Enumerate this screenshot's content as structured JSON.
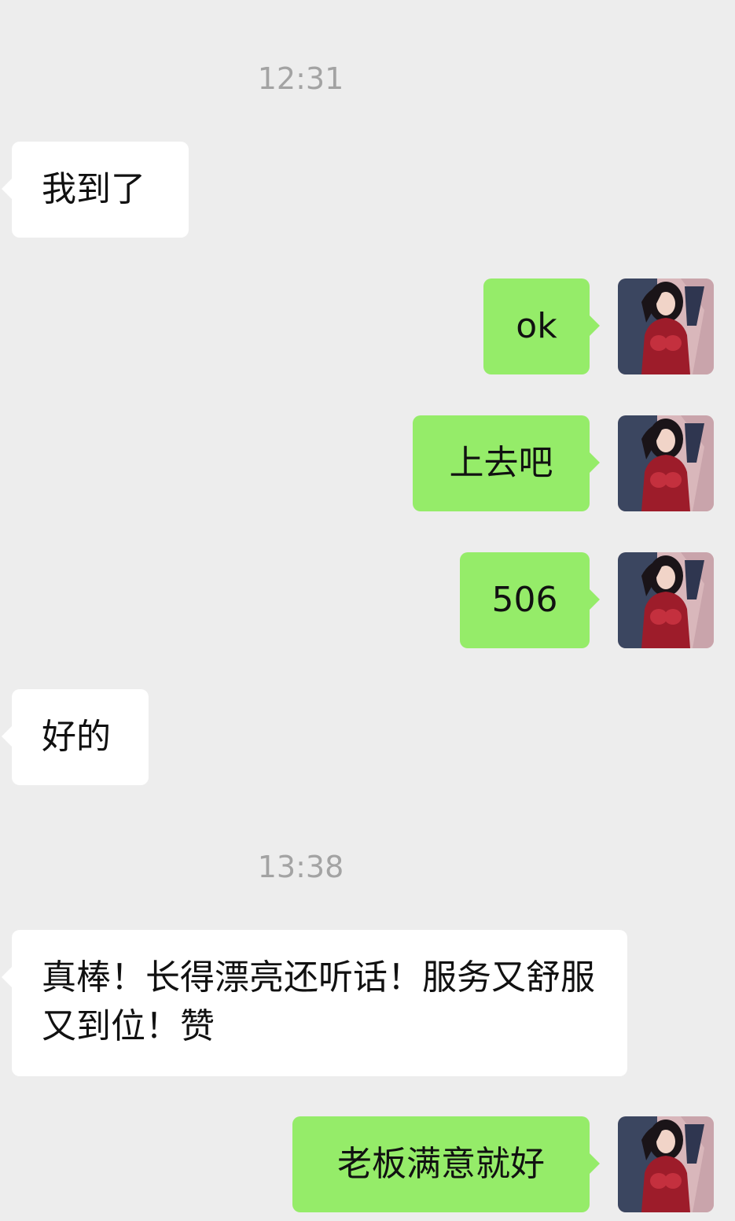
{
  "timestamps": [
    "12:31",
    "13:38"
  ],
  "messages": [
    {
      "side": "received",
      "text": "我到了"
    },
    {
      "side": "sent",
      "text": "ok"
    },
    {
      "side": "sent",
      "text": "上去吧"
    },
    {
      "side": "sent",
      "text": "506"
    },
    {
      "side": "received",
      "text": "好的"
    },
    {
      "side": "received",
      "text": "真棒！长得漂亮还听话！服务又舒服又到位！赞"
    },
    {
      "side": "sent",
      "text": "老板满意就好"
    }
  ],
  "colors": {
    "background": "#ededed",
    "sent_bubble": "#95ec69",
    "received_bubble": "#ffffff",
    "timestamp": "#a3a3a3"
  }
}
